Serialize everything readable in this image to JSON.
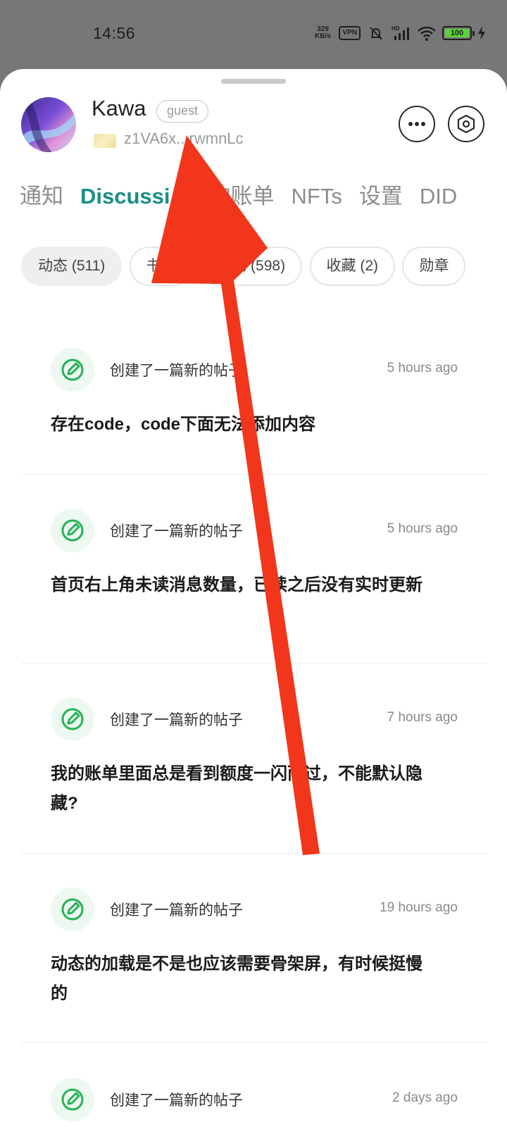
{
  "status_bar": {
    "time": "14:56",
    "net_speed_value": "329",
    "net_speed_unit": "KB/s",
    "vpn": "VPN",
    "battery": "100"
  },
  "profile": {
    "name": "Kawa",
    "badge": "guest",
    "wallet_address": "z1VA6x...rwmnLc"
  },
  "actions": {
    "more_icon": "more-dots-icon",
    "settings_icon": "hexagon-settings-icon"
  },
  "tabs": [
    {
      "label": "通知"
    },
    {
      "label": "Discussi"
    },
    {
      "label": "我的账单"
    },
    {
      "label": "NFTs"
    },
    {
      "label": "设置"
    },
    {
      "label": "DID"
    }
  ],
  "active_tab": "Discussi",
  "accent_color": "#1a8f86",
  "chips": [
    {
      "label": "动态 (511)"
    },
    {
      "label": "书签"
    },
    {
      "label": "评论 (598)"
    },
    {
      "label": "收藏 (2)"
    },
    {
      "label": "勋章"
    }
  ],
  "feed": [
    {
      "action": "创建了一篇新的帖子",
      "time": "5 hours ago",
      "title": "存在code，code下面无法添加内容"
    },
    {
      "action": "创建了一篇新的帖子",
      "time": "5 hours ago",
      "title": "首页右上角未读消息数量，已读之后没有实时更新"
    },
    {
      "action": "创建了一篇新的帖子",
      "time": "7 hours ago",
      "title": "我的账单里面总是看到额度一闪而过，不能默认隐藏?"
    },
    {
      "action": "创建了一篇新的帖子",
      "time": "19 hours ago",
      "title": "动态的加载是不是也应该需要骨架屏，有时候挺慢的"
    },
    {
      "action": "创建了一篇新的帖子",
      "time": "2 days ago",
      "title": ""
    }
  ],
  "annotation_color": "#f1361c"
}
